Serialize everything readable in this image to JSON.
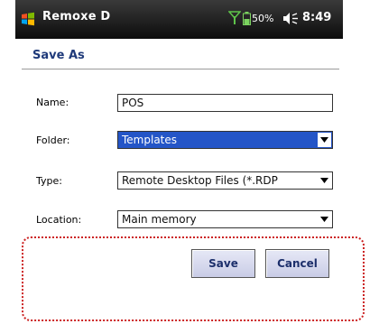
{
  "status_bar": {
    "app_title": "Remoxe D",
    "battery_percent": "50%",
    "time": "8:49",
    "icons": [
      "windows-start-icon",
      "signal-icon",
      "battery-icon",
      "speaker-icon"
    ]
  },
  "dialog": {
    "title": "Save As"
  },
  "form": {
    "name_label": "Name:",
    "name_value": "POS",
    "folder_label": "Folder:",
    "folder_value": "Templates",
    "type_label": "Type:",
    "type_value": "Remote Desktop Files (*.RDP",
    "location_label": "Location:",
    "location_value": "Main memory"
  },
  "buttons": {
    "save": "Save",
    "cancel": "Cancel"
  },
  "colors": {
    "selection": "#2455c7",
    "title": "#1f3a7a",
    "highlight": "#cc2222"
  }
}
